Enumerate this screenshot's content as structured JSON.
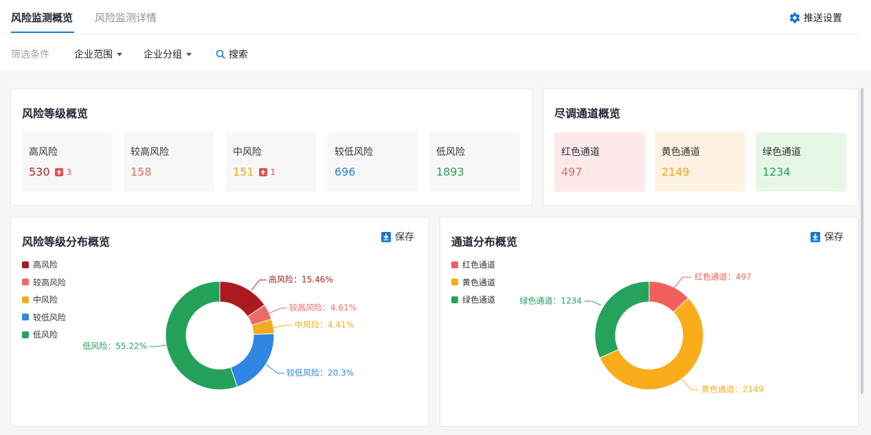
{
  "tabs": [
    {
      "label": "风险监测概览"
    },
    {
      "label": "风险监测详情"
    }
  ],
  "push_settings": "推送设置",
  "filters": {
    "label": "筛选条件",
    "enterprise_scope": "企业范围",
    "enterprise_group": "企业分组",
    "search": "搜索"
  },
  "risk_overview": {
    "title": "风险等级概览",
    "stats": [
      {
        "label": "高风险",
        "value": "530",
        "change": "3",
        "color": "#a3262a",
        "bg": "#f7f7f7"
      },
      {
        "label": "较高风险",
        "value": "158",
        "change": "",
        "color": "#e06b6b",
        "bg": "#f7f7f7"
      },
      {
        "label": "中风险",
        "value": "151",
        "change": "1",
        "color": "#f0a514",
        "bg": "#f7f7f7"
      },
      {
        "label": "较低风险",
        "value": "696",
        "change": "",
        "color": "#2f7fd0",
        "bg": "#f7f7f7"
      },
      {
        "label": "低风险",
        "value": "1893",
        "change": "",
        "color": "#2b9a5a",
        "bg": "#f7f7f7"
      }
    ]
  },
  "channel_overview": {
    "title": "尽调通道概览",
    "stats": [
      {
        "label": "红色通道",
        "value": "497",
        "color": "#e06b6b",
        "bg": "#fde9e9"
      },
      {
        "label": "黄色通道",
        "value": "2149",
        "color": "#f0a514",
        "bg": "#fdf2e2"
      },
      {
        "label": "绿色通道",
        "value": "1234",
        "color": "#2b9a5a",
        "bg": "#e6f7e6"
      }
    ]
  },
  "risk_dist": {
    "title": "风险等级分布概览",
    "save": "保存",
    "chart_data": {
      "type": "pie",
      "donut": true,
      "legend_position": "top-left",
      "series": [
        {
          "name": "高风险",
          "value": 15.46,
          "label": "高风险：15.46%",
          "color": "#ab1b1e"
        },
        {
          "name": "较高风险",
          "value": 4.61,
          "label": "较高风险：4.61%",
          "color": "#ee6a67"
        },
        {
          "name": "中风险",
          "value": 4.41,
          "label": "中风险：4.41%",
          "color": "#f5ab1c"
        },
        {
          "name": "较低风险",
          "value": 20.3,
          "label": "较低风险：20.3%",
          "color": "#2f86e3"
        },
        {
          "name": "低风险",
          "value": 55.22,
          "label": "低风险：55.22%",
          "color": "#24a159"
        }
      ]
    }
  },
  "channel_dist": {
    "title": "通道分布概览",
    "save": "保存",
    "chart_data": {
      "type": "pie",
      "donut": true,
      "legend_position": "top-left",
      "series": [
        {
          "name": "红色通道",
          "value": 497,
          "label": "红色通道：497",
          "color": "#f0615e"
        },
        {
          "name": "黄色通道",
          "value": 2149,
          "label": "黄色通道：2149",
          "color": "#f9ad1b"
        },
        {
          "name": "绿色通道",
          "value": 1234,
          "label": "绿色通道：1234",
          "color": "#25a35d"
        }
      ]
    }
  },
  "icons": {
    "settings": "gear-icon",
    "search": "search-icon",
    "save": "download-icon",
    "increase": "arrow-up-icon"
  }
}
